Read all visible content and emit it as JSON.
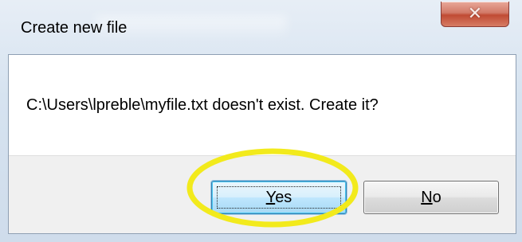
{
  "window": {
    "title": "Create new file",
    "close_icon": "close-icon"
  },
  "dialog": {
    "message": "C:\\Users\\lpreble\\myfile.txt doesn't exist. Create it?"
  },
  "buttons": {
    "yes": {
      "mnemonic": "Y",
      "rest": "es"
    },
    "no": {
      "mnemonic": "N",
      "rest": "o"
    }
  },
  "annotation": {
    "highlight_color": "#f2ea1c"
  }
}
